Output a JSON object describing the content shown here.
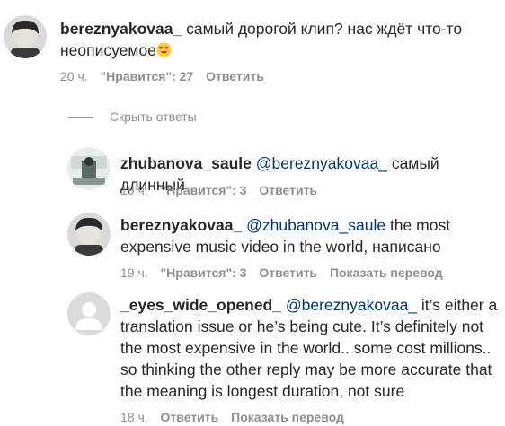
{
  "top_comment": {
    "username": "bereznyakovaa_",
    "text_line1": "самый дорогой клип? нас ждёт что-то",
    "text_line2": "неописуемое",
    "emoji": "heart-eyes-emoji",
    "time": "20 ч.",
    "likes_label": "\"Нравится\": 27",
    "reply_label": "Ответить"
  },
  "hide_replies_label": "Скрыть ответы",
  "replies": [
    {
      "username": "zhubanova_saule",
      "mention": "@bereznyakovaa_",
      "text": " самый длинный",
      "time": "19 ч.",
      "likes_label": "\"Нравится\": 3",
      "reply_label": "Ответить"
    },
    {
      "username": "bereznyakovaa_",
      "mention": "@zhubanova_saule",
      "text": " the most",
      "text_line2": "expensive music video in the world, написано",
      "time": "19 ч.",
      "likes_label": "\"Нравится\": 3",
      "reply_label": "Ответить",
      "translate_label": "Показать перевод"
    },
    {
      "username": "_eyes_wide_opened_",
      "mention": "@bereznyakovaa_",
      "text": " it’s either a",
      "text_line2": "translation issue or he’s being cute. It’s definitely not",
      "text_line3": "the most expensive in the world.. some cost millions..",
      "text_line4": "so thinking the other reply may be more accurate that",
      "text_line5": "the meaning is longest duration, not sure",
      "time": "18 ч.",
      "reply_label": "Ответить",
      "translate_label": "Показать перевод"
    }
  ]
}
